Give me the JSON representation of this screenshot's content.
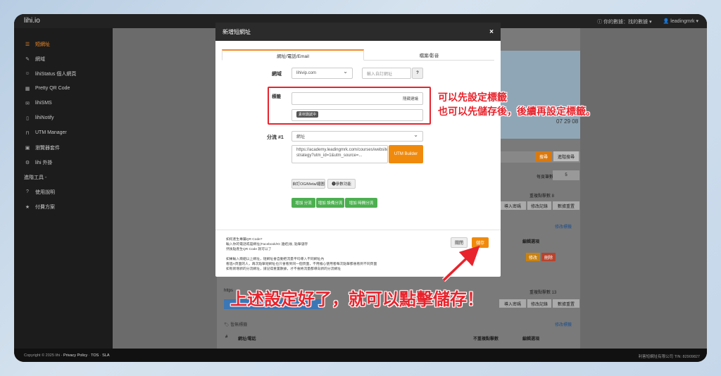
{
  "app": {
    "brand": "lihi.io"
  },
  "topbar": {
    "notice": "ⓘ 你的數據：找的數據 ▾",
    "user": "👤 leadingmrk ▾"
  },
  "sidebar": {
    "items": [
      {
        "icon": "list-icon",
        "glyph": "☰",
        "label": "短網址",
        "active": true
      },
      {
        "icon": "edit-icon",
        "glyph": "✎",
        "label": "網域"
      },
      {
        "icon": "user-icon",
        "glyph": "☺",
        "label": "lihiStatus 個人網頁"
      },
      {
        "icon": "qr-icon",
        "glyph": "▦",
        "label": "Pretty QR Code"
      },
      {
        "icon": "message-icon",
        "glyph": "✉",
        "label": "lihiSMS"
      },
      {
        "icon": "mobile-icon",
        "glyph": "▯",
        "label": "lihiNotify"
      },
      {
        "icon": "utm-icon",
        "glyph": "⊓",
        "label": "UTM Manager"
      },
      {
        "icon": "plugin-icon",
        "glyph": "▣",
        "label": "瀏覽器套件"
      },
      {
        "icon": "puzzle-icon",
        "glyph": "⚙",
        "label": "lihi 外掛"
      }
    ],
    "heading": "進階工具 -",
    "bottom": [
      {
        "icon": "help-icon",
        "glyph": "?",
        "label": "使用說明"
      },
      {
        "icon": "star-icon",
        "glyph": "★",
        "label": "付費方案"
      }
    ]
  },
  "footer": {
    "copyright": "Copyright © 2025 lihi - ",
    "links": [
      "Privacy Policy",
      "TOS",
      "SLA"
    ],
    "right": "利害短網址有限公司 TIN: 82909827"
  },
  "background": {
    "search_btn": "搜尋",
    "adv_search": "進階搜尋",
    "per_page": "每頁筆數",
    "per_page_val": "5",
    "clicks_label_1": "重複點擊數 8",
    "clicks_label_2": "重複點擊數 13",
    "btn_import": "導入密碼",
    "btn_log": "修改記錄",
    "btn_reset": "數據重置",
    "edit_tag": "修改標籤",
    "edit_col": "編輯選項",
    "btn_edit": "修改",
    "btn_delete": "刪除",
    "col_url": "網址/電話",
    "col_clicks": "不重複點擊數",
    "col_edit": "編輯選項",
    "row_prefix": "https",
    "hash": "#",
    "unlabeled": "🏷 暫無標籤",
    "date": "07 29 08"
  },
  "modal": {
    "title": "新增短網址",
    "close": "×",
    "tabs": [
      "網址/電話/Email",
      "檔案/影音"
    ],
    "domain_label": "網域",
    "domain_value": "lihivip.com",
    "custom_placeholder": "輸入自訂網址",
    "help_glyph": "?",
    "tag_label": "標籤",
    "hide_suggest": "隱藏建議",
    "tag_chip": "素材測試中",
    "route_label": "分流 #1",
    "route_type": "網址",
    "url_text": "https://academy.leadingmrk.com/courses/website-strategy?utm_id=1&utm_source=...",
    "utm_builder": "UTM Builder",
    "btn_og": "自訂OG/Meta/縮圖",
    "btn_params": "❶參數功能",
    "btn_add_route": "增加 分流",
    "btn_add_device": "增加 設備分流",
    "btn_add_geo": "增加 時間分流",
    "foot_lines_1": [
      "如何產生專屬QR Code?",
      "輸入你的電話或是網址(Facebook/IG 連結)後, 點擊儲存",
      "然後點產生QR Code 就可以了"
    ],
    "foot_lines_2": [
      "如果輸入兩組以上網址，短網址會自動把流量平均導入不同網址內",
      "看過A頁面的人，再次點擊短網址也只會看到同一個頁面，不用擔心使用者每次點擊都會看到不同頁面",
      "如有新增新的分流網址，請記得重置數據，才不會將流量都導向新的分流網址"
    ],
    "cancel": "關閉",
    "save": "儲存"
  },
  "annotations": {
    "tag_note_1": "可以先設定標籤",
    "tag_note_2": "也可以先儲存後，後續再設定標籤。",
    "save_note": "上述設定好了，就可以點擊儲存！"
  }
}
